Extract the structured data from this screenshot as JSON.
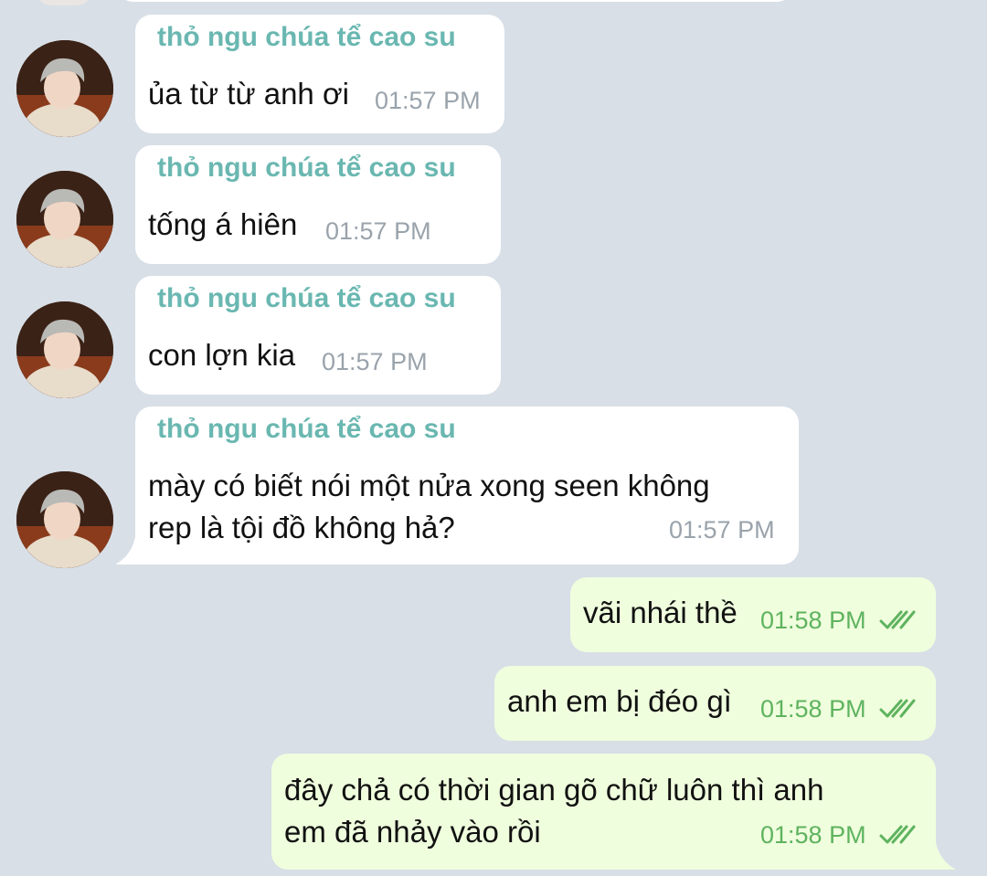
{
  "messages": [
    {
      "sender": "thỏ ngu chúa tể cao su",
      "text": "ủa từ từ anh ơi",
      "time": "01:57 PM"
    },
    {
      "sender": "thỏ ngu chúa tể cao su",
      "text": "tống á hiên",
      "time": "01:57 PM"
    },
    {
      "sender": "thỏ ngu chúa tể cao su",
      "text": "con lợn kia",
      "time": "01:57 PM"
    },
    {
      "sender": "thỏ ngu chúa tể cao su",
      "text_line1": "mày có biết nói một nửa xong seen không",
      "text_line2": "rep là tội đồ không hả?",
      "time": "01:57 PM"
    },
    {
      "text": "vãi nhái thề",
      "time": "01:58 PM",
      "status_icon": "double-check-icon"
    },
    {
      "text": "anh em bị đéo gì",
      "time": "01:58 PM",
      "status_icon": "double-check-icon"
    },
    {
      "text_line1": "đây chả có thời gian gõ chữ luôn thì anh",
      "text_line2": "em đã nhảy vào rồi",
      "time": "01:58 PM",
      "status_icon": "double-check-icon"
    }
  ],
  "colors": {
    "background": "#d8dfe7",
    "incoming_bubble": "#ffffff",
    "outgoing_bubble": "#effedd",
    "sender_name": "#6ab7b1",
    "outgoing_time": "#5fb35f"
  }
}
